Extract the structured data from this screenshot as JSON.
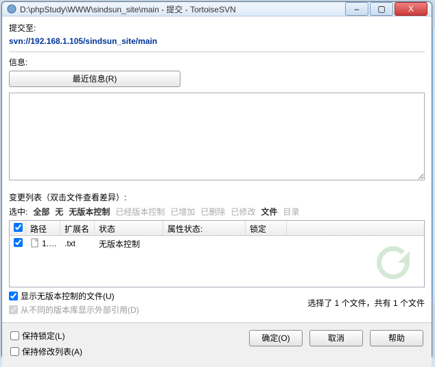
{
  "title": "D:\\phpStudy\\WWW\\sindsun_site\\main - 提交 - TortoiseSVN",
  "commit": {
    "to_label": "提交至:",
    "url": "svn://192.168.1.105/sindsun_site/main",
    "info_label": "信息:",
    "recent_btn": "最近信息(R)",
    "message_value": ""
  },
  "changes": {
    "heading": "变更列表（双击文件查看差异）:",
    "filter_label": "选中:",
    "filters": {
      "all": "全部",
      "none": "无",
      "unversioned": "无版本控制",
      "versioned": "已经版本控制",
      "added": "已增加",
      "deleted": "已删除",
      "modified": "已修改",
      "files": "文件",
      "dirs": "目录"
    },
    "columns": {
      "path": "路径",
      "ext": "扩展名",
      "status": "状态",
      "prop_status": "属性状态:",
      "lock": "锁定"
    },
    "rows": [
      {
        "checked": true,
        "path": "1.…",
        "ext": ".txt",
        "status": "无版本控制",
        "prop_status": "",
        "lock": ""
      }
    ],
    "show_unversioned_label": "显示无版本控制的文件(U)",
    "show_externals_label": "从不同的版本库显示外部引用(D)",
    "selection_summary": "选择了 1 个文件，共有 1 个文件"
  },
  "bottom": {
    "keep_locks": "保持锁定(L)",
    "keep_changelists": "保持修改列表(A)",
    "ok": "确定(O)",
    "cancel": "取消",
    "help": "帮助"
  },
  "window_controls": {
    "min": "–",
    "max": "▢",
    "close": "X"
  }
}
